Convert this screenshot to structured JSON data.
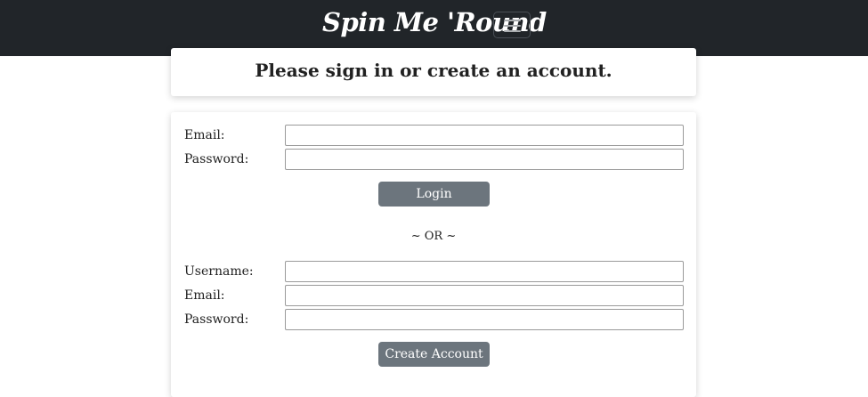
{
  "navbar": {
    "brand": "Spin Me 'Round",
    "menu_icon": "hamburger-menu-icon",
    "background": "#212529"
  },
  "title_card": {
    "heading": "Please sign in or create an account."
  },
  "login": {
    "email_label": "Email:",
    "email_value": "",
    "password_label": "Password:",
    "password_value": "",
    "button_label": "Login"
  },
  "divider": {
    "text": "~ OR ~"
  },
  "signup": {
    "username_label": "Username:",
    "username_value": "",
    "email_label": "Email:",
    "email_value": "",
    "password_label": "Password:",
    "password_value": "",
    "button_label": "Create Account"
  },
  "colors": {
    "button": "#6c757d",
    "navbar": "#212529"
  }
}
